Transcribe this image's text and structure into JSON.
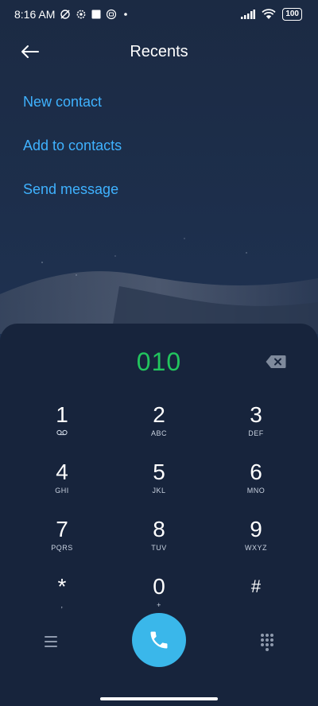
{
  "status_bar": {
    "time": "8:16 AM",
    "icons_left": [
      "alarm-off-icon",
      "settings-icon",
      "square-icon",
      "mi-icon",
      "dot-icon"
    ],
    "icons_right": [
      "signal-icon",
      "wifi-icon"
    ],
    "battery": "100"
  },
  "header": {
    "title": "Recents",
    "back_icon": "arrow-left-icon"
  },
  "options": [
    {
      "label": "New contact"
    },
    {
      "label": "Add to contacts"
    },
    {
      "label": "Send message"
    }
  ],
  "dialer": {
    "value": "010",
    "value_color": "#22c55e",
    "backspace_icon": "backspace-icon"
  },
  "keypad": [
    {
      "digit": "1",
      "sub": "voicemail-icon"
    },
    {
      "digit": "2",
      "sub": "ABC"
    },
    {
      "digit": "3",
      "sub": "DEF"
    },
    {
      "digit": "4",
      "sub": "GHI"
    },
    {
      "digit": "5",
      "sub": "JKL"
    },
    {
      "digit": "6",
      "sub": "MNO"
    },
    {
      "digit": "7",
      "sub": "PQRS"
    },
    {
      "digit": "8",
      "sub": "TUV"
    },
    {
      "digit": "9",
      "sub": "WXYZ"
    },
    {
      "digit": "*",
      "sub": ","
    },
    {
      "digit": "0",
      "sub": "+"
    },
    {
      "digit": "#",
      "sub": ""
    }
  ],
  "bottom_bar": {
    "menu_icon": "menu-icon",
    "call_icon": "phone-icon",
    "call_color": "#3ab7ea",
    "keypad_icon": "dialpad-icon"
  },
  "colors": {
    "accent": "#3fb2ff",
    "background": "#1c2b42",
    "sheet": "#17243c"
  }
}
